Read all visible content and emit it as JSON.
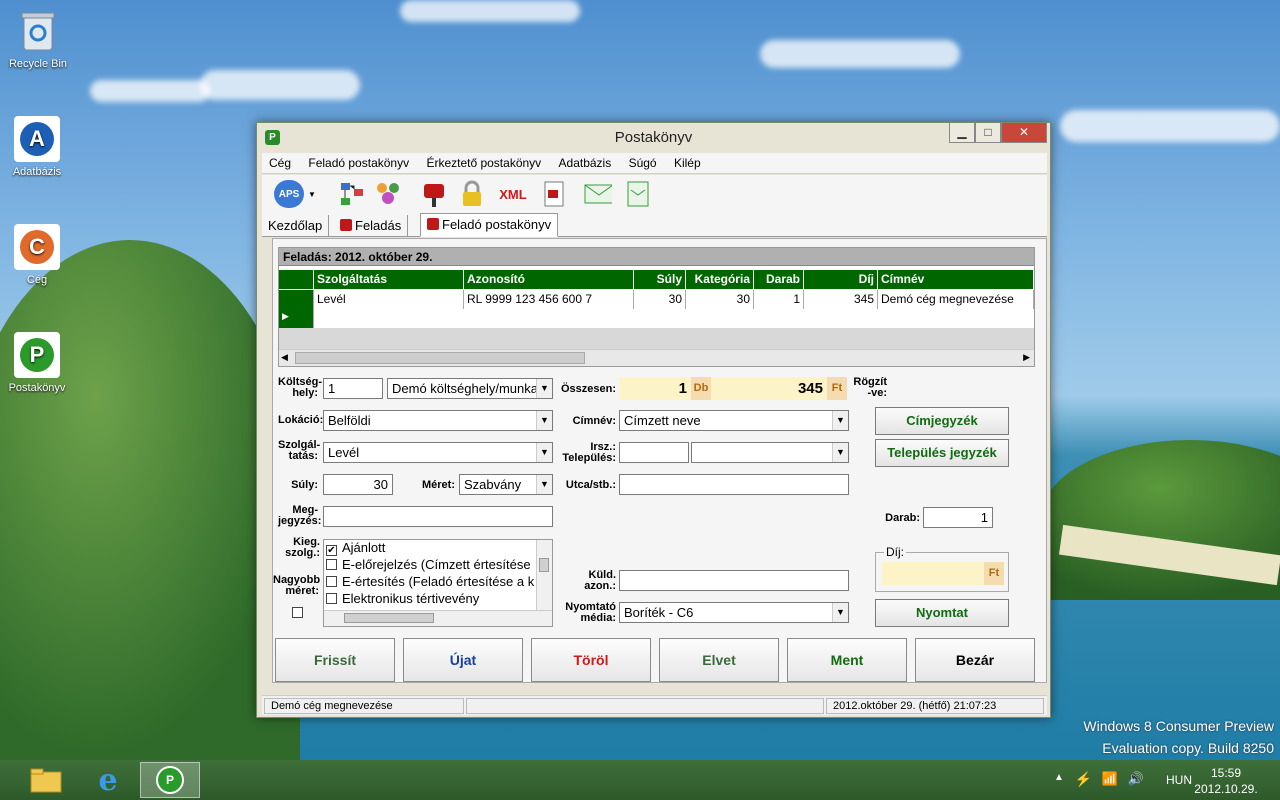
{
  "desktop": {
    "icons": [
      {
        "label": "Recycle Bin"
      },
      {
        "label": "Adatbázis"
      },
      {
        "label": "Cég"
      },
      {
        "label": "Postakönyv"
      }
    ],
    "watermark_line1": "Windows 8 Consumer Preview",
    "watermark_line2": "Evaluation copy. Build 8250"
  },
  "window": {
    "title": "Postakönyv",
    "controls": {
      "minimize": "▁",
      "maximize": "□",
      "close": "✕"
    }
  },
  "menu": [
    "Cég",
    "Feladó postakönyv",
    "Érkeztető postakönyv",
    "Adatbázis",
    "Súgó",
    "Kilép"
  ],
  "toolbar": {
    "aps_label": "APS",
    "xml_label": "XML"
  },
  "tabs": [
    "Kezdőlap",
    "Feladás",
    "Feladó postakönyv"
  ],
  "grid": {
    "heading": "Feladás: 2012. október 29.",
    "columns": [
      "Szolgáltatás",
      "Azonosító",
      "Súly",
      "Kategória",
      "Darab",
      "Díj",
      "Címnév"
    ],
    "rows": [
      [
        "Levél",
        "RL 9999 123 456 600 7",
        "30",
        "30",
        "1",
        "345",
        "Demó cég megnevezése"
      ]
    ]
  },
  "form": {
    "koltseghely_label": "Költség-\nhely:",
    "koltseghely_code": "1",
    "koltseghely_name": "Demó költséghely/munka",
    "lokacio_label": "Lokáció:",
    "lokacio": "Belföldi",
    "szolgaltatas_label": "Szolgál-\ntatás:",
    "szolgaltatas": "Levél",
    "suly_label": "Súly:",
    "suly": "30",
    "meret_label": "Méret:",
    "meret": "Szabvány",
    "megjegyzes_label": "Meg-\njegyzés:",
    "megjegyzes": "",
    "kieg_label": "Kieg.\nszolg.:",
    "nagyobb_label": "Nagyobb\nméret:",
    "kieg_items": [
      {
        "label": "Ajánlott",
        "checked": true
      },
      {
        "label": "E-előrejelzés (Címzett értesítése",
        "checked": false
      },
      {
        "label": "E-értesítés (Feladó értesítése a k",
        "checked": false
      },
      {
        "label": "Elektronikus tértivevény",
        "checked": false
      }
    ],
    "osszesen_label": "Összesen:",
    "osszesen_db": "1",
    "db_unit": "Db",
    "osszesen_ft": "345",
    "ft_unit": "Ft",
    "rogzitve_label": "Rögzít\n-ve:",
    "cimnev_label": "Címnév:",
    "cimnev": "Címzett neve",
    "irsz_label": "Irsz.:\nTelepülés:",
    "irsz": "",
    "telepules": "",
    "utca_label": "Utca/stb.:",
    "utca": "",
    "kuld_label": "Küld.\nazon.:",
    "kuld": "",
    "nyomtato_label": "Nyomtató\nmédia:",
    "nyomtato": "Boríték - C6",
    "darab_label": "Darab:",
    "darab": "1",
    "dij_label": "Díj:",
    "dij": "",
    "cimjegyzek_btn": "Címjegyzék",
    "telepules_btn": "Település jegyzék",
    "nyomtat_btn": "Nyomtat"
  },
  "buttons": {
    "frissit": "Frissít",
    "ujat": "Újat",
    "torol": "Töröl",
    "elvet": "Elvet",
    "ment": "Ment",
    "bezar": "Bezár"
  },
  "colors": {
    "frissit": "#3a6a3a",
    "ujat": "#1a3ea0",
    "torol": "#d01818",
    "elvet": "#3a6a3a",
    "ment": "#116b11",
    "bezar": "#000000"
  },
  "status": {
    "company": "Demó cég megnevezése",
    "datetime": "2012.október 29. (hétfő) 21:07:23"
  },
  "taskbar": {
    "language": "HUN",
    "time": "15:59",
    "date": "2012.10.29."
  }
}
